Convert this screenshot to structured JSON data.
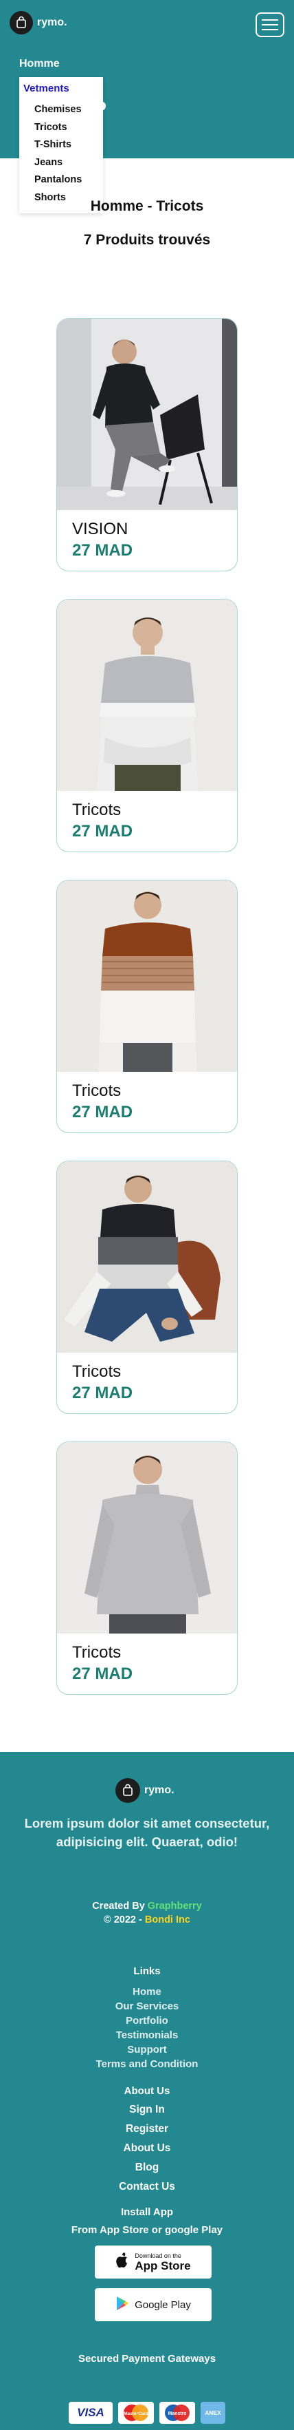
{
  "header": {
    "brand": "rymo.",
    "nav_home": "Homme",
    "dropdown_title": "Vetments",
    "dropdown_items": [
      "Chemises",
      "Tricots",
      "T-Shirts",
      "Jeans",
      "Pantalons",
      "Shorts"
    ]
  },
  "main": {
    "title": "Homme - Tricots",
    "count": "7 Produits trouvés",
    "products": [
      {
        "name": "VISION",
        "price": "27 MAD"
      },
      {
        "name": "Tricots",
        "price": "27 MAD"
      },
      {
        "name": "Tricots",
        "price": "27 MAD"
      },
      {
        "name": "Tricots",
        "price": "27 MAD"
      },
      {
        "name": "Tricots",
        "price": "27 MAD"
      }
    ]
  },
  "footer": {
    "brand": "rymo.",
    "tagline": "Lorem ipsum dolor sit amet consectetur, adipisicing elit. Quaerat, odio!",
    "created_by_label": "Created By",
    "created_by_name": "Graphberry",
    "copyright_label": "© 2022 -",
    "copyright_name": "Bondi Inc",
    "links_heading": "Links",
    "links": [
      "Home",
      "Our Services",
      "Portfolio",
      "Testimonials",
      "Support",
      "Terms and Condition"
    ],
    "about_heading": "About Us",
    "about_links": [
      "Sign In",
      "Register",
      "About Us",
      "Blog",
      "Contact Us"
    ],
    "install_heading": "Install App",
    "install_sub": "From App Store or google Play",
    "app_store_small": "Download on the",
    "app_store_big": "App Store",
    "google_play_label": "Google Play",
    "payment_heading": "Secured Payment Gateways",
    "payments": [
      "VISA",
      "MasterCard",
      "Maestro",
      "AMEX"
    ]
  },
  "colors": {
    "teal": "#238890",
    "price_green": "#1a7d6f",
    "active_nav": "#1f17c8",
    "credit_green": "#62e07a",
    "credit_yellow": "#ffd21c"
  }
}
